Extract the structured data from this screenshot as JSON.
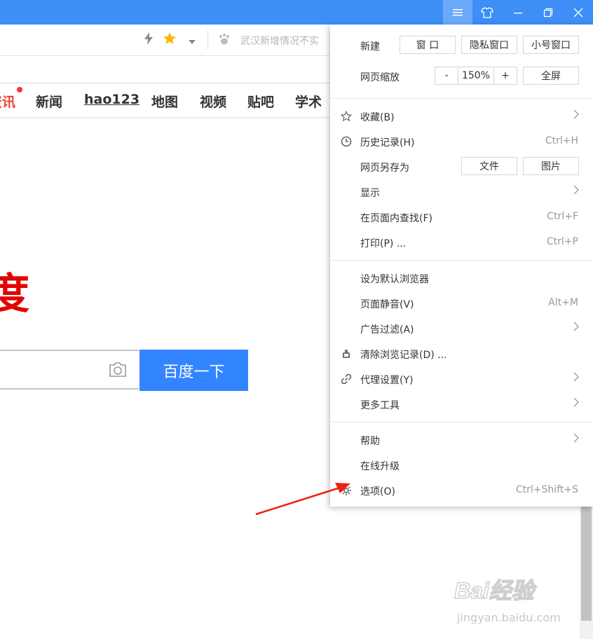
{
  "titlebar": {
    "menu_icon": "hamburger-icon",
    "skin_icon": "tshirt-icon",
    "minimize_icon": "minimize-icon",
    "restore_icon": "restore-icon",
    "close_icon": "close-icon"
  },
  "addressbar": {
    "news_text": "武汉新增情况不实"
  },
  "nav": {
    "items": [
      {
        "label": "资讯"
      },
      {
        "label": "新闻"
      },
      {
        "label": "hao123"
      },
      {
        "label": "地图"
      },
      {
        "label": "视频"
      },
      {
        "label": "贴吧"
      },
      {
        "label": "学术"
      }
    ]
  },
  "page": {
    "logo_fragment": "度",
    "search_button": "百度一下"
  },
  "menu": {
    "new_label": "新建",
    "new_window": "窗 口",
    "private_window": "隐私窗口",
    "small_window": "小号窗口",
    "zoom_label": "网页缩放",
    "zoom_minus": "-",
    "zoom_value": "150%",
    "zoom_plus": "+",
    "fullscreen": "全屏",
    "favorites": "收藏(B)",
    "history": "历史记录(H)",
    "history_shortcut": "Ctrl+H",
    "save_as": "网页另存为",
    "save_file": "文件",
    "save_image": "图片",
    "display": "显示",
    "find": "在页面内查找(F)",
    "find_shortcut": "Ctrl+F",
    "print": "打印(P) ...",
    "print_shortcut": "Ctrl+P",
    "default_browser": "设为默认浏览器",
    "mute": "页面静音(V)",
    "mute_shortcut": "Alt+M",
    "ad_filter": "广告过滤(A)",
    "clear_history": "清除浏览记录(D) ...",
    "proxy": "代理设置(Y)",
    "more_tools": "更多工具",
    "help": "帮助",
    "upgrade": "在线升级",
    "options": "选项(O)",
    "options_shortcut": "Ctrl+Shift+S"
  },
  "watermark": {
    "brand": "Bai经验",
    "url": "jingyan.baidu.com"
  }
}
